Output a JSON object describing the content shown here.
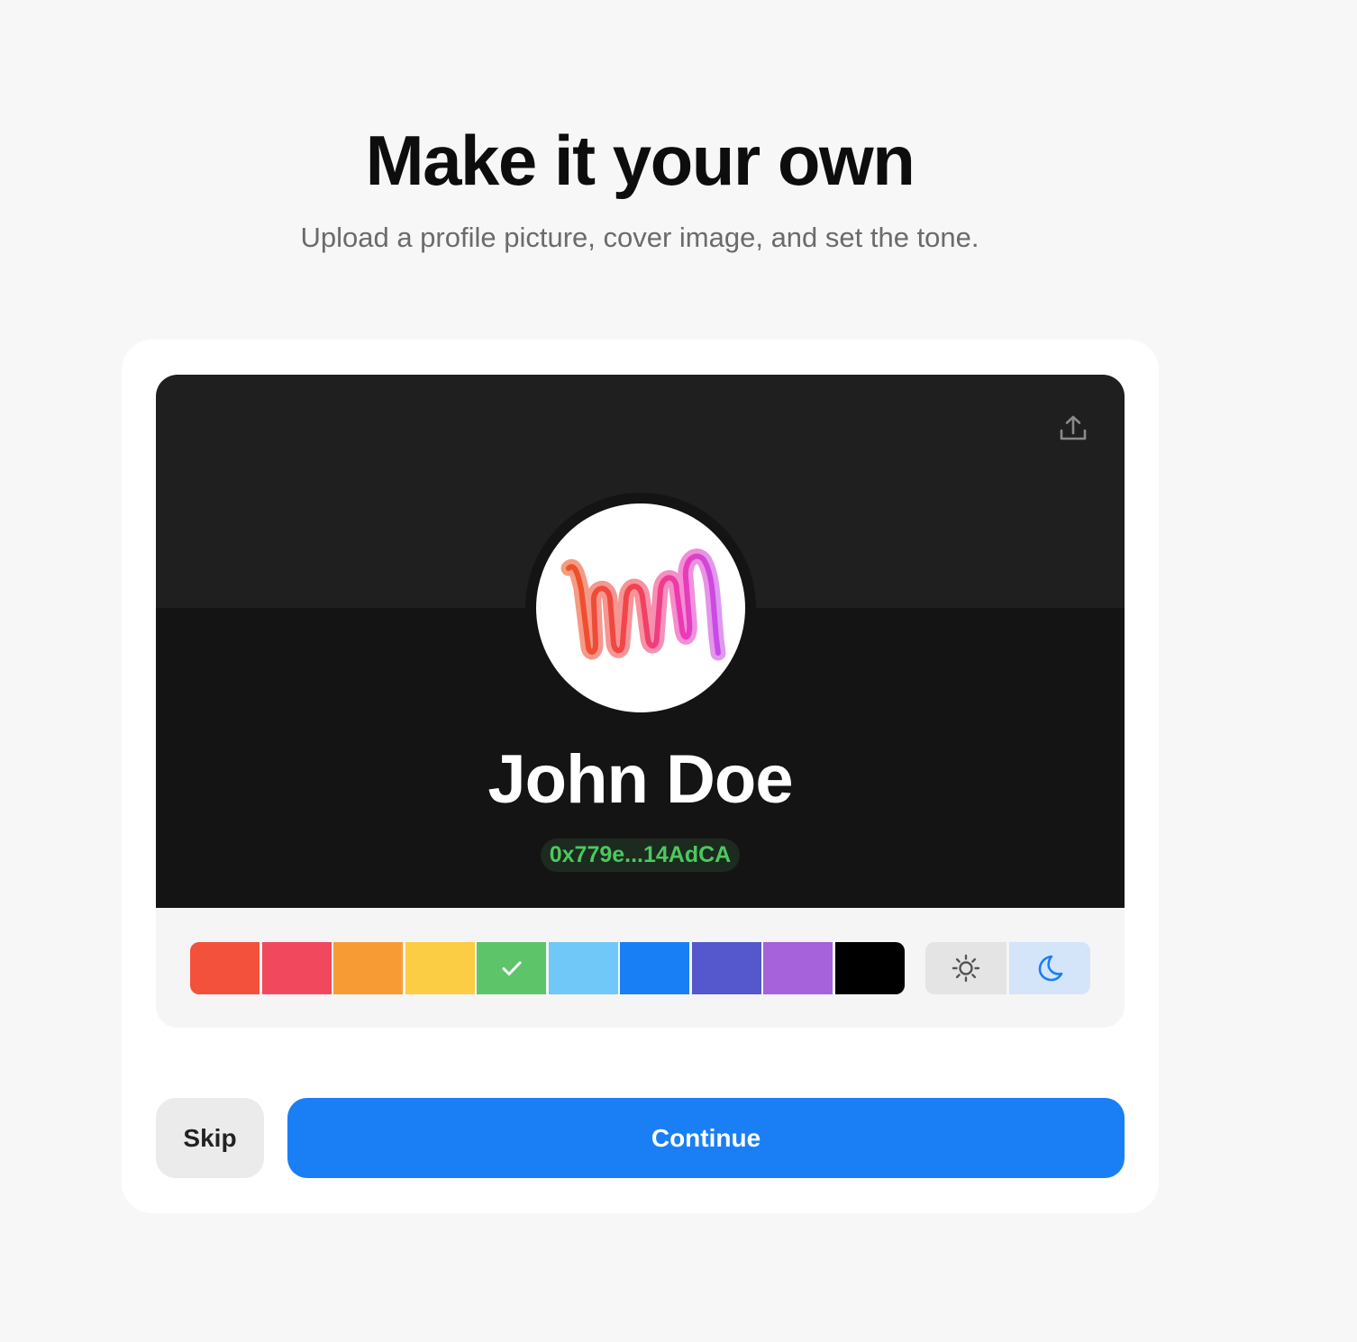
{
  "header": {
    "title": "Make it your own",
    "subtitle": "Upload a profile picture, cover image, and set the tone."
  },
  "profile": {
    "display_name": "John Doe",
    "wallet_address": "0x779e...14AdCA",
    "cover_color": "#1f1f1f",
    "background_color": "#141414"
  },
  "icons": {
    "upload": "upload-icon",
    "checkmark": "checkmark-icon",
    "sun": "sun-icon",
    "moon": "moon-icon"
  },
  "color_picker": {
    "selected": "green",
    "swatches": [
      {
        "name": "red",
        "color": "#f3513b"
      },
      {
        "name": "pink",
        "color": "#f2485e"
      },
      {
        "name": "orange",
        "color": "#f79c35"
      },
      {
        "name": "yellow",
        "color": "#fbcd45"
      },
      {
        "name": "green",
        "color": "#5ec46a"
      },
      {
        "name": "light-blue",
        "color": "#6fc8f7"
      },
      {
        "name": "blue",
        "color": "#197ff4"
      },
      {
        "name": "indigo",
        "color": "#5458cc"
      },
      {
        "name": "purple",
        "color": "#a562da"
      },
      {
        "name": "black",
        "color": "#000000"
      }
    ]
  },
  "theme": {
    "selected": "dark",
    "light_bg": "#e4e4e4",
    "dark_bg": "#d4e5f9",
    "dark_icon_color": "#1a7ff5"
  },
  "actions": {
    "skip_label": "Skip",
    "continue_label": "Continue",
    "continue_color": "#1a7ff5"
  }
}
